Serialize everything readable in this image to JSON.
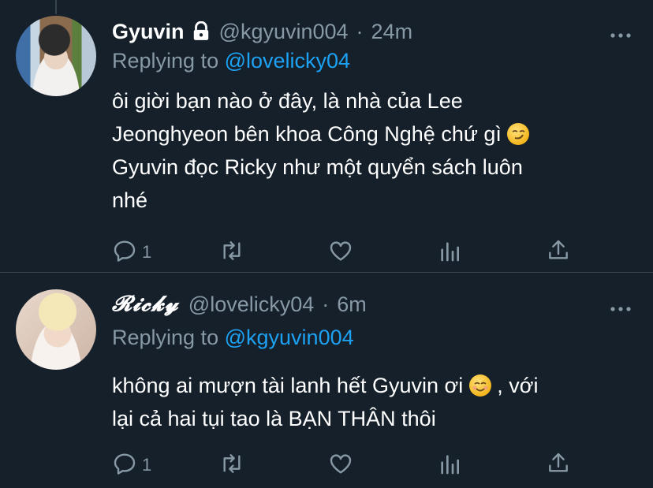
{
  "tweets": [
    {
      "name": "Gyuvin",
      "locked": true,
      "handle": "@kgyuvin004",
      "separator": "·",
      "time": "24m",
      "replying_prefix": "Replying to",
      "replying_to": "@lovelicky04",
      "lines": [
        "ôi giời bạn nào ở đây, là nhà của Lee",
        "Jeonghyeon bên khoa Công Nghệ chứ gì",
        "Gyuvin đọc Ricky như một quyển sách luôn",
        "nhé"
      ],
      "emoji": "smirking-face-emoji",
      "reply_count": "1"
    },
    {
      "name": "𝓡𝓲𝓬𝓴𝔂",
      "locked": false,
      "handle": "@lovelicky04",
      "separator": "·",
      "time": "6m",
      "replying_prefix": "Replying to",
      "replying_to": "@kgyuvin004",
      "lines": [
        "không ai mượn tài lanh hết Gyuvin ơi",
        ", với",
        "lại cả hai tụi tao là BẠN THÂN thôi"
      ],
      "emoji": "smiling-face-emoji",
      "reply_count": "1"
    }
  ],
  "colors": {
    "background": "#15202b",
    "text": "#ffffff",
    "secondary": "#8899a6",
    "link": "#1da1f2",
    "divider": "#38444d"
  }
}
